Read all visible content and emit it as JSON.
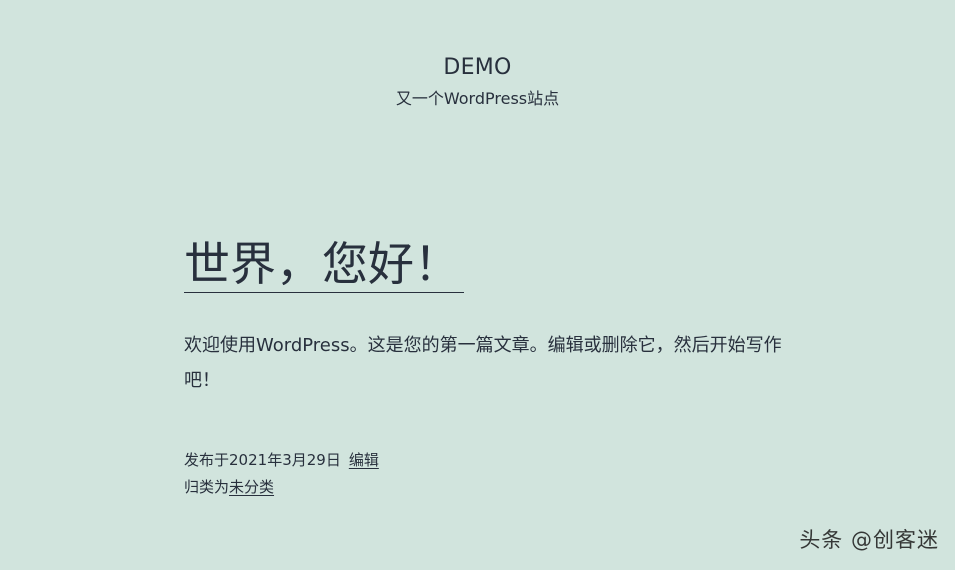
{
  "site": {
    "title": "DEMO",
    "tagline": "又一个WordPress站点"
  },
  "post": {
    "title": "世界，您好！",
    "content": "欢迎使用WordPress。这是您的第一篇文章。编辑或删除它，然后开始写作吧！",
    "published_prefix": "发布于",
    "published_date": "2021年3月29日",
    "edit_label": "编辑",
    "category_prefix": "归类为",
    "category": "未分类"
  },
  "watermark": {
    "text": "头条 @创客迷"
  },
  "colors": {
    "background": "#d1e4dd",
    "text": "#28303d"
  }
}
